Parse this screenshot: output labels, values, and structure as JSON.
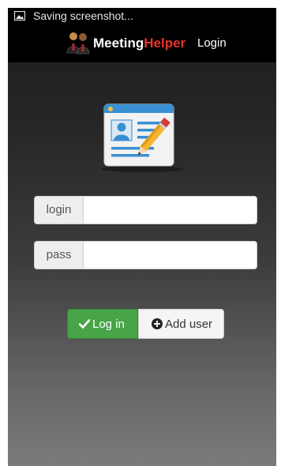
{
  "status_bar": {
    "icon": "image-icon",
    "text": "Saving screenshot..."
  },
  "action_bar": {
    "logo_icon": "meeting-people-icon",
    "title_part1": "Meeting",
    "title_part2": "Helper",
    "login_link": "Login",
    "title_color": "#ffffff",
    "title_accent_color": "#e8332f"
  },
  "form": {
    "illustration_icon": "contact-card-pencil-icon",
    "login_label": "login",
    "login_value": "",
    "pass_label": "pass",
    "pass_value": "",
    "login_button": "Log in",
    "login_button_icon": "checkmark-icon",
    "login_button_color": "#47a447",
    "add_user_button": "Add user",
    "add_user_button_icon": "plus-circle-icon"
  }
}
